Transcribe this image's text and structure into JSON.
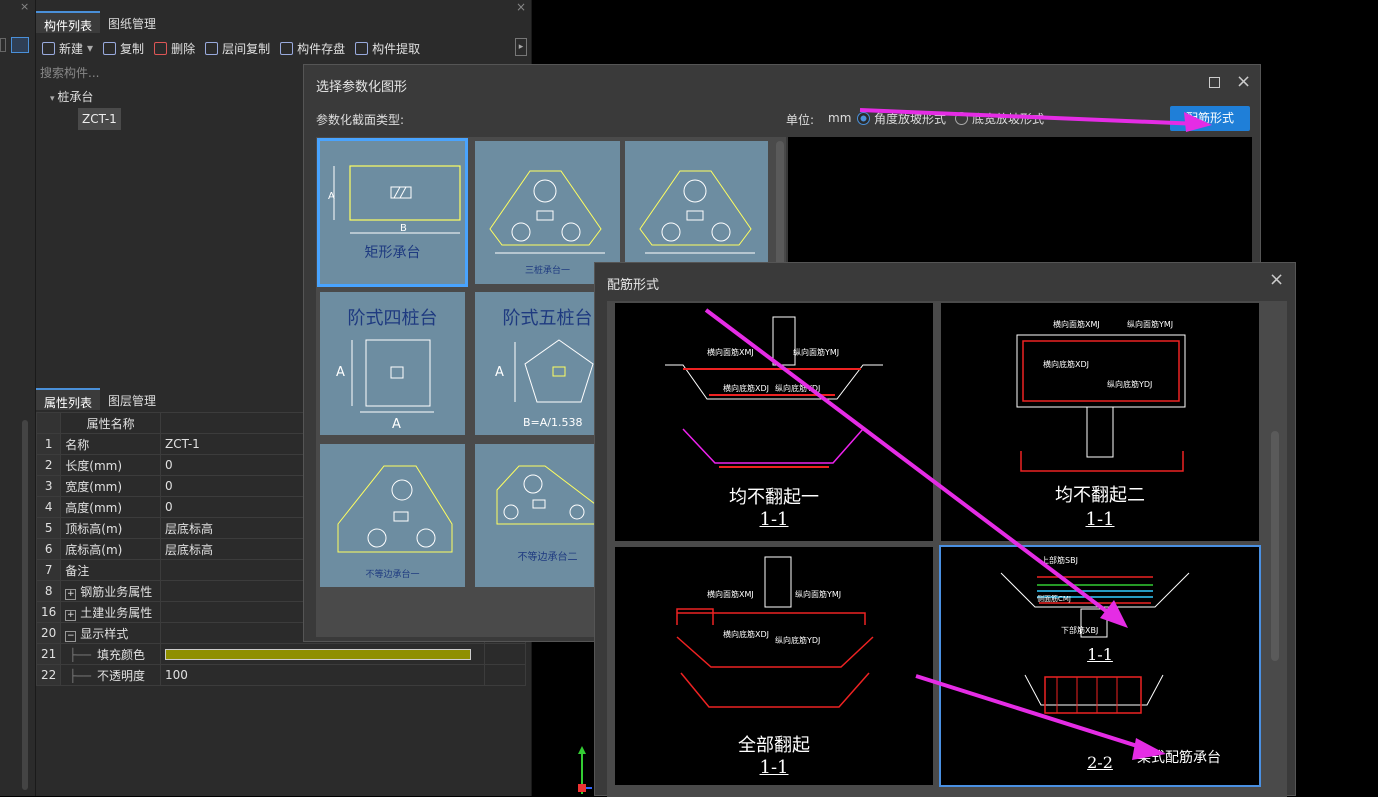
{
  "left_panel": {
    "tabs": [
      "构件列表",
      "图纸管理"
    ],
    "toolbar": [
      "新建",
      "复制",
      "删除",
      "层间复制",
      "构件存盘",
      "构件提取"
    ],
    "search_placeholder": "搜索构件...",
    "tree": {
      "root": "桩承台",
      "child": "ZCT-1"
    }
  },
  "props_panel": {
    "tabs": [
      "属性列表",
      "图层管理"
    ],
    "header": "属性名称",
    "rows": [
      {
        "num": "1",
        "name": "名称",
        "value": "ZCT-1",
        "blue": true
      },
      {
        "num": "2",
        "name": "长度(mm)",
        "value": "0",
        "blue": true
      },
      {
        "num": "3",
        "name": "宽度(mm)",
        "value": "0",
        "blue": true
      },
      {
        "num": "4",
        "name": "高度(mm)",
        "value": "0",
        "blue": true
      },
      {
        "num": "5",
        "name": "顶标高(m)",
        "value": "层底标高",
        "blue": false
      },
      {
        "num": "6",
        "name": "底标高(m)",
        "value": "层底标高",
        "blue": false
      },
      {
        "num": "7",
        "name": "备注",
        "value": "",
        "blue": false
      },
      {
        "num": "8",
        "name": "钢筋业务属性",
        "value": "",
        "blue": false,
        "expand": "+"
      },
      {
        "num": "16",
        "name": "土建业务属性",
        "value": "",
        "blue": false,
        "expand": "+"
      },
      {
        "num": "20",
        "name": "显示样式",
        "value": "",
        "blue": false,
        "expand": "-"
      },
      {
        "num": "21",
        "name": "填充颜色",
        "value": "",
        "blue": false,
        "color": "#8f8f00"
      },
      {
        "num": "22",
        "name": "不透明度",
        "value": "100",
        "blue": false
      }
    ]
  },
  "dialog1": {
    "title": "选择参数化图形",
    "type_label": "参数化截面类型:",
    "unit_label": "单位:",
    "unit_value": "mm",
    "radio1": "角度放坡形式",
    "radio2": "底宽放坡形式",
    "button": "配筋形式",
    "cells": [
      {
        "label": "矩形承台"
      },
      {
        "label": "三桩承台一"
      },
      {
        "label": ""
      },
      {
        "label": "阶式四桩台"
      },
      {
        "label": "阶式五桩台"
      },
      {
        "label": "不等边承台一"
      },
      {
        "label": "不等边承台二"
      }
    ],
    "dim_A": "A",
    "dim_B": "B",
    "formula": "B=A/1.538"
  },
  "dialog2": {
    "title": "配筋形式",
    "cells": [
      {
        "title": "均不翻起一",
        "section": "1-1"
      },
      {
        "title": "均不翻起二",
        "section": "1-1"
      },
      {
        "title": "全部翻起",
        "section": "1-1"
      },
      {
        "title": "梁式配筋承台",
        "section": "1-1",
        "section2": "2-2"
      }
    ],
    "rebar_labels": [
      "横向面筋XMJ",
      "纵向面筋YMJ",
      "横向底筋XDJ",
      "纵向底筋YDJ",
      "上部筋SBJ",
      "下部筋XBJ",
      "侧面筋CMJ"
    ]
  },
  "colors": {
    "accent": "#1f7fd8",
    "arrow": "#e52ce5",
    "cell_bg": "#6d8da1"
  }
}
